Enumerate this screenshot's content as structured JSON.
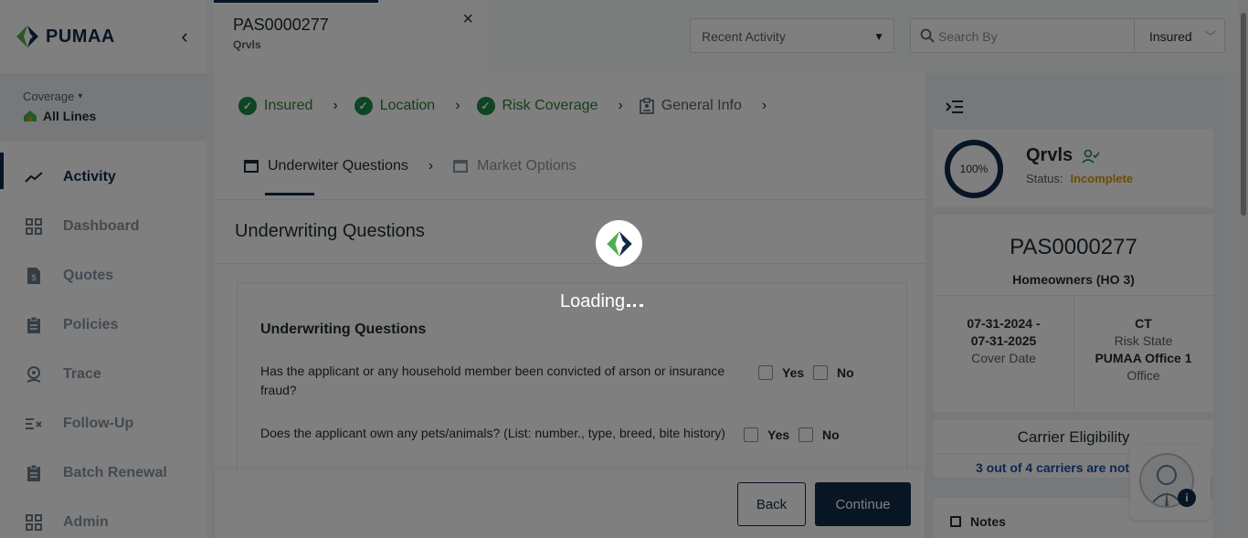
{
  "app": {
    "brand": "PUMAA",
    "collapse_icon": "chevron-left-icon"
  },
  "sidebar": {
    "coverage_label": "Coverage",
    "coverage_value": "All Lines",
    "items": [
      {
        "label": "Activity",
        "icon": "trend-icon",
        "active": true
      },
      {
        "label": "Dashboard",
        "icon": "grid-icon",
        "active": false
      },
      {
        "label": "Quotes",
        "icon": "quote-doc-icon",
        "active": false
      },
      {
        "label": "Policies",
        "icon": "clipboard-icon",
        "active": false
      },
      {
        "label": "Trace",
        "icon": "location-icon",
        "active": false
      },
      {
        "label": "Follow-Up",
        "icon": "list-check-icon",
        "active": false
      },
      {
        "label": "Batch Renewal",
        "icon": "clipboard-icon",
        "active": false
      },
      {
        "label": "Admin",
        "icon": "grid-icon",
        "active": false
      }
    ]
  },
  "topbar": {
    "tab_title": "PAS0000277",
    "tab_subtitle": "Qrvls",
    "close": "×",
    "recent_activity": "Recent Activity",
    "search_placeholder": "Search By",
    "search_type": "Insured"
  },
  "steps": [
    {
      "label": "Insured",
      "done": true
    },
    {
      "label": "Location",
      "done": true
    },
    {
      "label": "Risk Coverage",
      "done": true
    },
    {
      "label": "General Info",
      "done": false
    }
  ],
  "subtabs": [
    {
      "label": "Underwiter Questions",
      "active": true
    },
    {
      "label": "Market Options",
      "active": false
    }
  ],
  "main": {
    "section_title": "Underwriting Questions",
    "card_title": "Underwriting Questions",
    "questions": [
      {
        "text": "Has the applicant or any household member been convicted of arson or insurance fraud?",
        "yes": "Yes",
        "no": "No"
      },
      {
        "text": "Does the applicant own any pets/animals? (List: number., type, breed, bite history)",
        "yes": "Yes",
        "no": "No"
      }
    ],
    "back_label": "Back",
    "continue_label": "Continue"
  },
  "summary": {
    "progress": "100%",
    "insured_name": "Qrvls",
    "status_label": "Status:",
    "status_value": "Incomplete",
    "policy_number": "PAS0000277",
    "policy_type": "Homeowners (HO 3)",
    "cover_date_from": "07-31-2024 -",
    "cover_date_to": "07-31-2025",
    "cover_date_label": "Cover Date",
    "state": "CT",
    "state_label": "Risk State",
    "office": "PUMAA Office 1",
    "office_label": "Office",
    "carrier_title": "Carrier Eligibility",
    "carrier_text": "3 out of 4 carriers are not e",
    "notes_label": "Notes",
    "help_badge": "i"
  },
  "loading": {
    "text": "Loading"
  },
  "colors": {
    "brand_navy": "#0f2a4a",
    "success_green": "#1b8b4a",
    "status_orange": "#d99a00",
    "link_blue": "#1a4fa0"
  }
}
